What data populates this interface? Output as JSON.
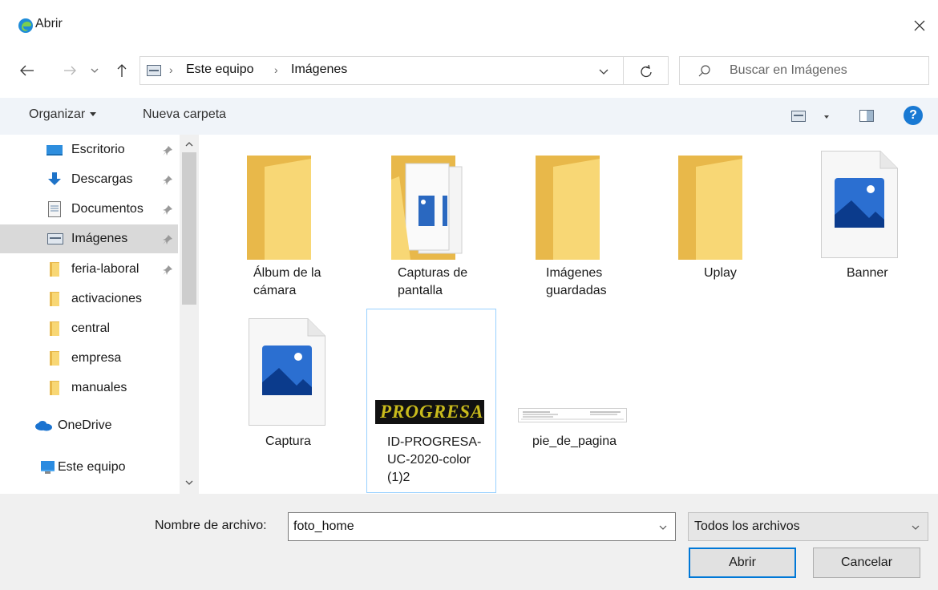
{
  "window": {
    "title": "Abrir",
    "app_icon": "edge-browser-icon",
    "close_icon": "close-icon"
  },
  "navigation": {
    "back_icon": "arrow-left-icon",
    "forward_icon": "arrow-right-icon",
    "recent_icon": "chevron-down-icon",
    "up_icon": "arrow-up-icon",
    "breadcrumb": [
      "Este equipo",
      "Imágenes"
    ],
    "refresh_icon": "refresh-icon",
    "search_placeholder": "Buscar en Imágenes"
  },
  "toolbar": {
    "organize_label": "Organizar",
    "new_folder_label": "Nueva carpeta",
    "view_icon": "view-options-icon",
    "preview_pane_icon": "preview-pane-icon",
    "help_icon": "help-icon",
    "help_glyph": "?"
  },
  "sidebar": {
    "items": [
      {
        "label": "Escritorio",
        "icon": "desktop-icon",
        "pinned": true
      },
      {
        "label": "Descargas",
        "icon": "download-icon",
        "pinned": true
      },
      {
        "label": "Documentos",
        "icon": "documents-icon",
        "pinned": true
      },
      {
        "label": "Imágenes",
        "icon": "pictures-icon",
        "pinned": true,
        "selected": true
      },
      {
        "label": "feria-laboral",
        "icon": "folder-icon",
        "pinned": true
      },
      {
        "label": "activaciones",
        "icon": "folder-icon",
        "pinned": false
      },
      {
        "label": "central",
        "icon": "folder-icon",
        "pinned": false
      },
      {
        "label": "empresa",
        "icon": "folder-icon",
        "pinned": false
      },
      {
        "label": "manuales",
        "icon": "folder-icon",
        "pinned": false
      },
      {
        "label": "OneDrive",
        "icon": "onedrive-icon",
        "pinned": false
      },
      {
        "label": "Este equipo",
        "icon": "this-pc-icon",
        "pinned": false
      }
    ]
  },
  "files": [
    {
      "name_line1": "Álbum de la",
      "name_line2": "cámara",
      "name_line3": "",
      "kind": "folder"
    },
    {
      "name_line1": "Capturas de",
      "name_line2": "pantalla",
      "name_line3": "",
      "kind": "folder-with-docs"
    },
    {
      "name_line1": "Imágenes",
      "name_line2": "guardadas",
      "name_line3": "",
      "kind": "folder"
    },
    {
      "name_line1": "Uplay",
      "name_line2": "",
      "name_line3": "",
      "kind": "folder"
    },
    {
      "name_line1": "Banner",
      "name_line2": "",
      "name_line3": "",
      "kind": "image-file"
    },
    {
      "name_line1": "Captura",
      "name_line2": "",
      "name_line3": "",
      "kind": "image-file"
    },
    {
      "name_line1": "ID-PROGRESA-",
      "name_line2": "UC-2020-color",
      "name_line3": "(1)2",
      "kind": "logo-thumbnail",
      "selected": true,
      "thumb_text": "PROGRESA"
    },
    {
      "name_line1": "pie_de_pagina",
      "name_line2": "",
      "name_line3": "",
      "kind": "document-strip-thumbnail"
    }
  ],
  "footer": {
    "filename_label": "Nombre de archivo:",
    "filename_value": "foto_home",
    "filetype_value": "Todos los archivos",
    "open_button": "Abrir",
    "cancel_button": "Cancelar"
  },
  "colors": {
    "folder": "#f8d775",
    "folder_dark": "#e8b84a",
    "accent": "#0078d7",
    "toolbar_bg": "#f0f4f9",
    "selection": "#99d1ff",
    "footer_bg": "#f0f0f0"
  }
}
